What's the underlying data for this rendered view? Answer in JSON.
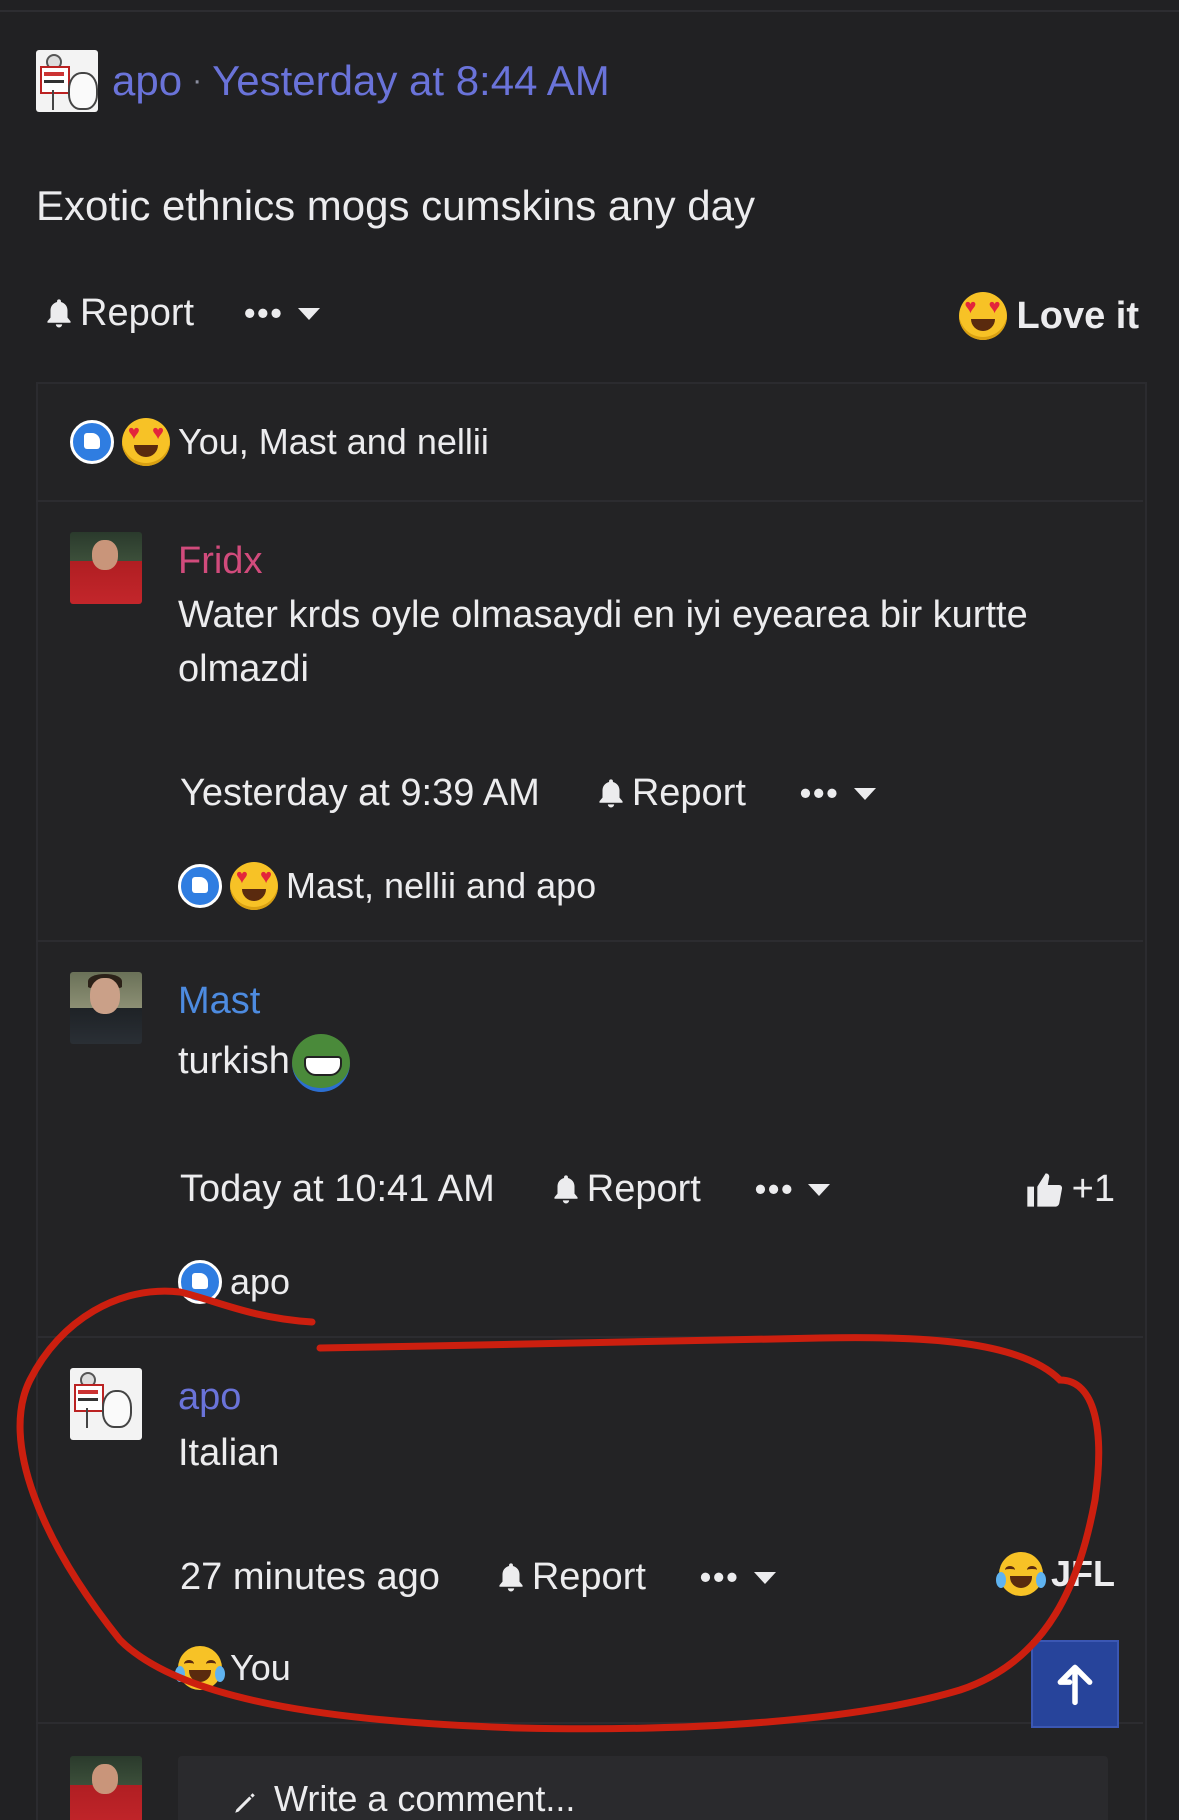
{
  "post": {
    "author": "apo",
    "separator": "·",
    "time": "Yesterday at 8:44 AM",
    "body": "Exotic ethnics mogs cumskins any day",
    "report_label": "Report",
    "more_label": "•••",
    "reaction_label": "Love it",
    "reaction_summary": "You, Mast and nellii"
  },
  "comments": [
    {
      "author": "Fridx",
      "author_color": "#d14b7c",
      "text": "Water krds oyle olmasaydi en iyi eyearea bir kurtte olmazdi",
      "time": "Yesterday at 9:39 AM",
      "report_label": "Report",
      "more_label": "•••",
      "reaction_summary": "Mast, nellii and apo"
    },
    {
      "author": "Mast",
      "author_color": "#4d8be0",
      "text": "turkish",
      "time": "Today at 10:41 AM",
      "report_label": "Report",
      "more_label": "•••",
      "reaction_label": "+1",
      "reaction_summary": "apo"
    },
    {
      "author": "apo",
      "author_color": "#6a73d9",
      "text": "Italian",
      "time": "27 minutes ago",
      "report_label": "Report",
      "more_label": "•••",
      "reaction_label": "JFL",
      "reaction_summary": "You"
    }
  ],
  "composer": {
    "placeholder": "Write a comment..."
  },
  "colors": {
    "background": "#212123",
    "link": "#6a73d9",
    "scroll_button": "#27449b",
    "annotation": "#cc1f0f"
  },
  "icons": [
    "bell-icon",
    "caret-down-icon",
    "heart-eyes-emoji",
    "like-icon",
    "joy-emoji",
    "thumbs-up-icon",
    "arrow-up-icon",
    "pencil-icon",
    "pepe-emoji"
  ]
}
